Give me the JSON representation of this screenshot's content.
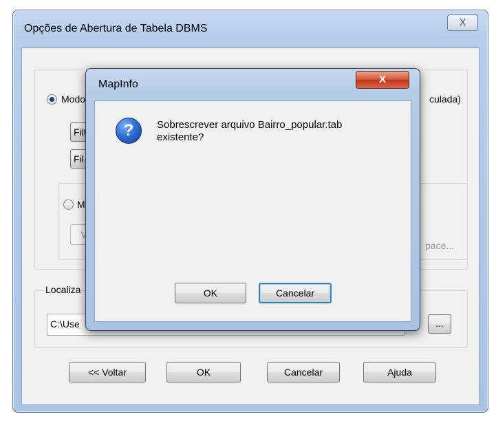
{
  "back_dialog": {
    "title": "Opções de Abertura de Tabela DBMS",
    "close_glyph": "X",
    "mode_radio_label": "Modo",
    "filter_btn_1": "Filt",
    "filter_btn_2": "Fil",
    "right_partial_label": "culada)",
    "radio2_label": "M",
    "view_btn": "V",
    "space_label": "pace...",
    "localization_label": "Localiza",
    "path_value": "C:\\Use",
    "browse_label": "...",
    "buttons": {
      "back": "<< Voltar",
      "ok": "OK",
      "cancel": "Cancelar",
      "help": "Ajuda"
    }
  },
  "message_box": {
    "title": "MapInfo",
    "close_glyph": "X",
    "icon": "question-icon",
    "message_line1": "Sobrescrever arquivo Bairro_popular.tab",
    "message_line2": "existente?",
    "ok": "OK",
    "cancel": "Cancelar"
  }
}
